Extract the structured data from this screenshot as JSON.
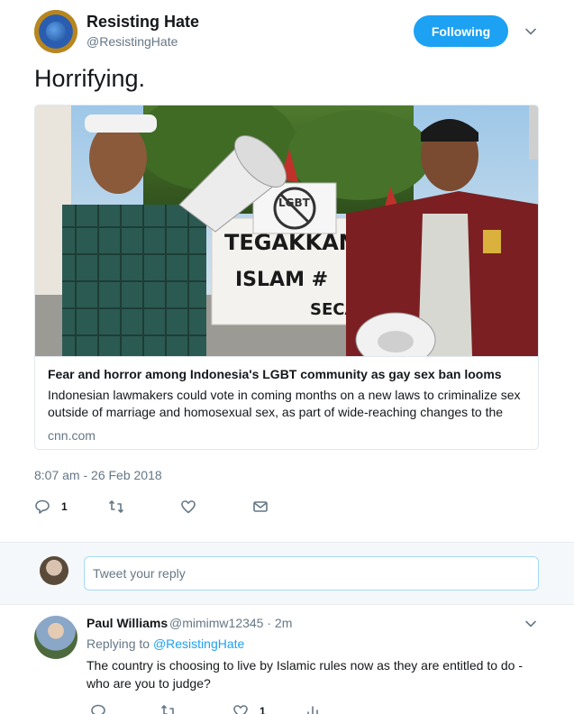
{
  "tweet": {
    "display_name": "Resisting Hate",
    "handle": "@ResistingHate",
    "follow_button": "Following",
    "text": "Horrifying.",
    "timestamp": "8:07 am - 26 Feb 2018",
    "actions": {
      "reply_count": "1",
      "retweet_count": "",
      "like_count": ""
    }
  },
  "card": {
    "image": {
      "sign_top": "LGBT",
      "banner_lines": [
        "TEGAKKAN",
        "ISLAM #",
        "SECA"
      ]
    },
    "title": "Fear and horror among Indonesia's LGBT community as gay sex ban looms",
    "description": "Indonesian lawmakers could vote in coming months on a new laws to criminalize sex outside of marriage and homosexual sex, as part of wide-reaching changes to the",
    "domain": "cnn.com"
  },
  "reply_composer": {
    "placeholder": "Tweet your reply"
  },
  "reply": {
    "display_name": "Paul Williams",
    "handle_time": "@mimimw12345 · 2m",
    "replying_prefix": "Replying to",
    "replying_mention": "@ResistingHate",
    "text": "The country is choosing to live by Islamic rules now as they are entitled to do - who are you to judge?",
    "like_count": "1"
  },
  "colors": {
    "accent": "#1da1f2",
    "secondary_text": "#657786",
    "border": "#e1e8ed",
    "composer_bg": "#f5f8fa"
  },
  "icons": [
    "reply-icon",
    "retweet-icon",
    "like-icon",
    "message-icon",
    "chevron-down-icon",
    "analytics-icon"
  ]
}
